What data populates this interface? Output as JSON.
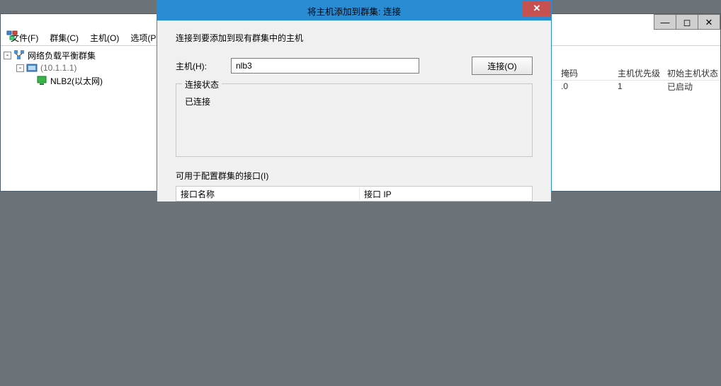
{
  "main_window": {
    "menus": {
      "file": "文件(F)",
      "cluster": "群集(C)",
      "host": "主机(O)",
      "options": "选项(P)"
    },
    "win_controls": {
      "min": "—",
      "max": "◻",
      "close": "✕"
    },
    "tree": {
      "root": "网络负载平衡群集",
      "cluster": "(10.1.1.1)",
      "host": "NLB2(以太网)"
    },
    "list": {
      "headers": {
        "mask": "掩码",
        "priority": "主机优先级",
        "state": "初始主机状态"
      },
      "row0": {
        "mask_tail": ".0",
        "priority": "1",
        "state": "已启动"
      }
    }
  },
  "dialog": {
    "title": "将主机添加到群集: 连接",
    "close_glyph": "✕",
    "instruction": "连接到要添加到现有群集中的主机",
    "host_label": "主机(H):",
    "host_value": "nlb3",
    "connect_btn": "连接(O)",
    "group_legend": "连接状态",
    "group_status": "已连接",
    "ifaces_label": "可用于配置群集的接口(I)",
    "iface_cols": {
      "name": "接口名称",
      "ip": "接口 IP"
    }
  }
}
